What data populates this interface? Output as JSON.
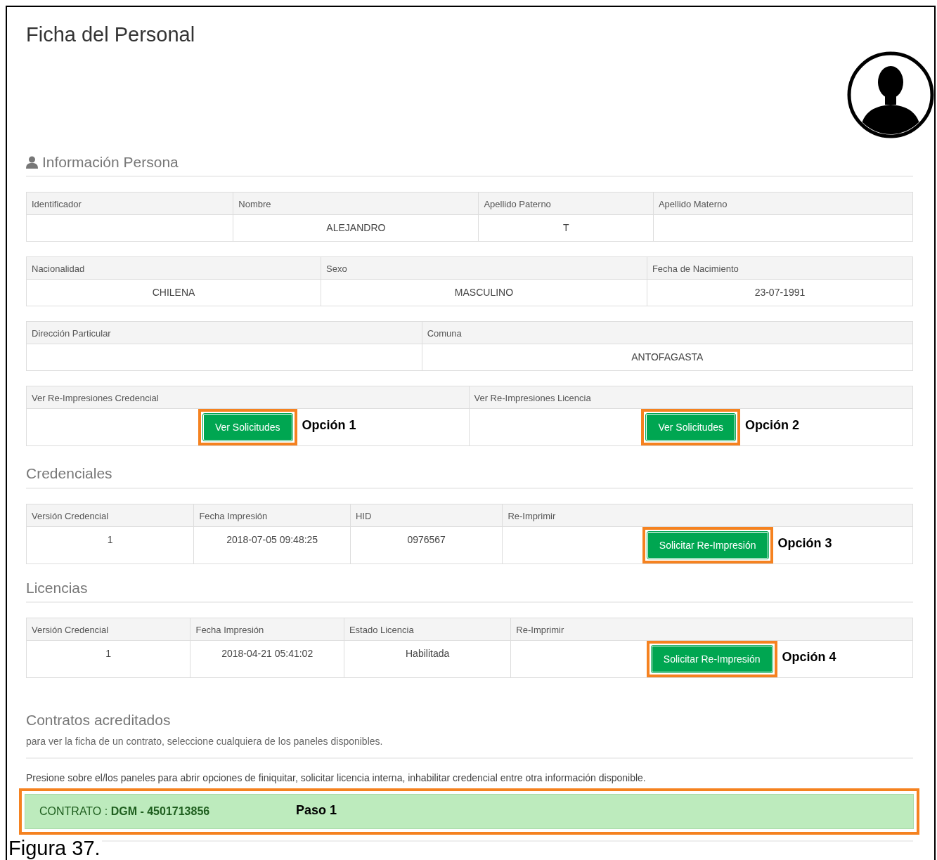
{
  "page": {
    "title": "Ficha del Personal"
  },
  "info_section": {
    "title": "Información Persona",
    "tables": [
      [
        {
          "label": "Identificador",
          "kind": "text"
        },
        {
          "label": "Nombre",
          "kind": "text",
          "value": "ALEJANDRO"
        },
        {
          "label": "Apellido Paterno",
          "kind": "text",
          "value": "T"
        },
        {
          "label": "Apellido Materno",
          "kind": "text"
        }
      ],
      [
        {
          "label": "Nacionalidad",
          "kind": "text",
          "value": "CHILENA"
        },
        {
          "label": "Sexo",
          "kind": "text",
          "value": "MASCULINO"
        },
        {
          "label": "Fecha de Nacimiento",
          "kind": "text",
          "value": "23-07-1991"
        }
      ],
      [
        {
          "label": "Dirección Particular",
          "kind": "text"
        },
        {
          "label": "Comuna",
          "kind": "text",
          "value": "ANTOFAGASTA"
        }
      ],
      [
        {
          "label": "Ver Re-Impresiones Credencial",
          "kind": "button",
          "button": "Ver Solicitudes",
          "highlighted": true,
          "annotation": "Opción 1"
        },
        {
          "label": "Ver Re-Impresiones Licencia",
          "kind": "button",
          "button": "Ver Solicitudes",
          "highlighted": true,
          "annotation": "Opción 2"
        }
      ]
    ]
  },
  "record_sections": [
    {
      "title": "Credenciales",
      "columns": [
        "Versión Credencial",
        "Fecha Impresión",
        "HID",
        "Re-Imprimir"
      ],
      "rows": [
        [
          {
            "kind": "text",
            "value": "1"
          },
          {
            "kind": "text",
            "value": "2018-07-05 09:48:25"
          },
          {
            "kind": "text",
            "value": "0976567"
          },
          {
            "kind": "button",
            "button": "Solicitar Re-Impresión",
            "highlighted": true,
            "annotation": "Opción 3"
          }
        ]
      ]
    },
    {
      "title": "Licencias",
      "columns": [
        "Versión Credencial",
        "Fecha Impresión",
        "Estado Licencia",
        "Re-Imprimir"
      ],
      "rows": [
        [
          {
            "kind": "text",
            "value": "1"
          },
          {
            "kind": "text",
            "value": "2018-04-21 05:41:02"
          },
          {
            "kind": "text",
            "value": "Habilitada"
          },
          {
            "kind": "button",
            "button": "Solicitar Re-Impresión",
            "highlighted": true,
            "annotation": "Opción 4"
          }
        ]
      ]
    }
  ],
  "contracts": {
    "title": "Contratos acreditados",
    "subtitle": "para ver la ficha de un contrato, seleccione cualquiera de los paneles disponibles.",
    "instruction": "Presione sobre el/los paneles para abrir opciones de finiquitar, solicitar licencia interna, inhabilitar credencial entre otra información disponible.",
    "panels": [
      {
        "label": "CONTRATO : **DGM - 4501713856**",
        "highlighted": true,
        "annotation": "Paso 1"
      }
    ]
  },
  "caption": "Figura 37."
}
